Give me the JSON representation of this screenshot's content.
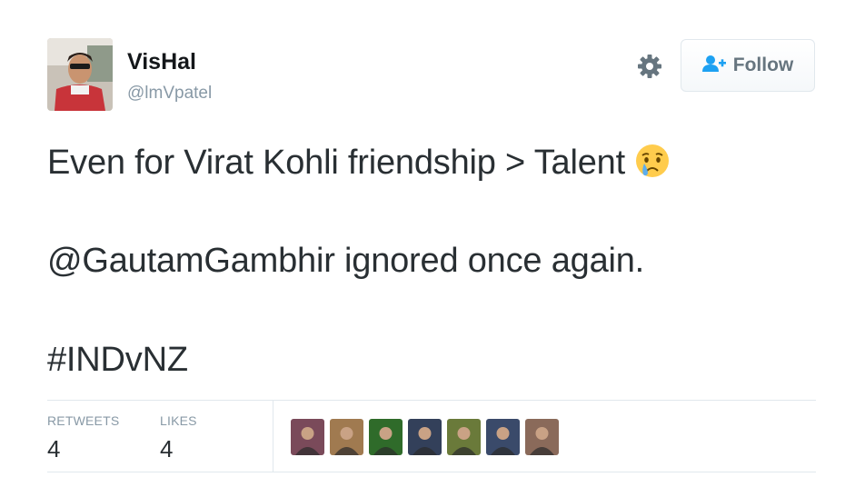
{
  "user": {
    "display_name": "VisHal",
    "handle": "@lmVpatel",
    "avatar_icon": "user-avatar-photo"
  },
  "actions": {
    "settings_icon": "gear-icon",
    "follow_label": "Follow",
    "follow_icon": "add-person-icon"
  },
  "tweet": {
    "line1_text": "Even for Virat Kohli friendship > Talent",
    "line1_emoji": "crying-face-emoji",
    "line2_mention": "@GautamGambhir",
    "line2_rest": " ignored once again.",
    "line3_hashtag": "#INDvNZ"
  },
  "stats": {
    "retweets_label": "RETWEETS",
    "retweets_count": "4",
    "likes_label": "LIKES",
    "likes_count": "4"
  },
  "likers": [
    {
      "name": "liker-avatar-1",
      "accent": "#7a4a5a"
    },
    {
      "name": "liker-avatar-2",
      "accent": "#a07a50"
    },
    {
      "name": "liker-avatar-3",
      "accent": "#2f6b2a"
    },
    {
      "name": "liker-avatar-4",
      "accent": "#33405a"
    },
    {
      "name": "liker-avatar-5",
      "accent": "#6a7a3a"
    },
    {
      "name": "liker-avatar-6",
      "accent": "#3a4a6a"
    },
    {
      "name": "liker-avatar-7",
      "accent": "#8a6a5a"
    }
  ],
  "colors": {
    "text": "#292f33",
    "secondary": "#8899a6",
    "follow_icon": "#1da1f2",
    "border": "#e1e8ed"
  }
}
